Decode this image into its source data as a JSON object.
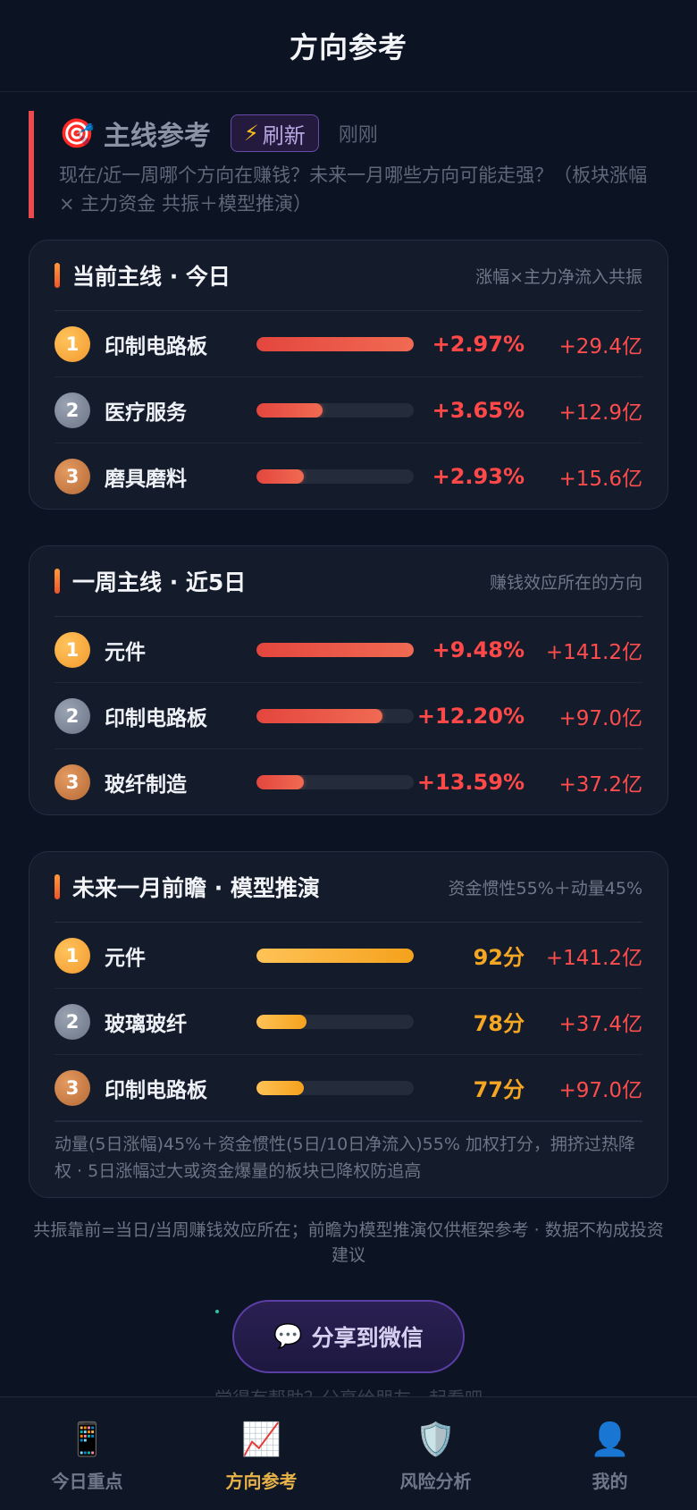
{
  "header": {
    "title": "方向参考"
  },
  "intro": {
    "icon": "🎯",
    "title": "主线参考",
    "refresh_icon": "⚡",
    "refresh_label": "刷新",
    "time": "刚刚",
    "description": "现在/近一周哪个方向在赚钱？未来一月哪些方向可能走强？（板块涨幅 × 主力资金 共振＋模型推演）"
  },
  "cards": [
    {
      "title": "当前主线 · 今日",
      "subtitle": "涨幅×主力净流入共振",
      "bar_style": "red",
      "rows": [
        {
          "rank": "1",
          "name": "印制电路板",
          "level": 1.0,
          "value": "+2.97%",
          "flow": "+29.4亿"
        },
        {
          "rank": "2",
          "name": "医疗服务",
          "level": 0.42,
          "value": "+3.65%",
          "flow": "+12.9亿"
        },
        {
          "rank": "3",
          "name": "磨具磨料",
          "level": 0.3,
          "value": "+2.93%",
          "flow": "+15.6亿"
        }
      ]
    },
    {
      "title": "一周主线 · 近5日",
      "subtitle": "赚钱效应所在的方向",
      "bar_style": "red",
      "rows": [
        {
          "rank": "1",
          "name": "元件",
          "level": 1.0,
          "value": "+9.48%",
          "flow": "+141.2亿"
        },
        {
          "rank": "2",
          "name": "印制电路板",
          "level": 0.8,
          "value": "+12.20%",
          "flow": "+97.0亿"
        },
        {
          "rank": "3",
          "name": "玻纤制造",
          "level": 0.3,
          "value": "+13.59%",
          "flow": "+37.2亿"
        }
      ]
    },
    {
      "title": "未来一月前瞻 · 模型推演",
      "subtitle": "资金惯性55%＋动量45%",
      "bar_style": "orange",
      "rows": [
        {
          "rank": "1",
          "name": "元件",
          "level": 1.0,
          "value": "92分",
          "flow": "+141.2亿"
        },
        {
          "rank": "2",
          "name": "玻璃玻纤",
          "level": 0.32,
          "value": "78分",
          "flow": "+37.4亿"
        },
        {
          "rank": "3",
          "name": "印制电路板",
          "level": 0.3,
          "value": "77分",
          "flow": "+97.0亿"
        }
      ],
      "note": "动量(5日涨幅)45%＋资金惯性(5日/10日净流入)55% 加权打分，拥挤过热降权 · 5日涨幅过大或资金爆量的板块已降权防追高"
    }
  ],
  "footer_note": "共振靠前=当日/当周赚钱效应所在；前瞻为模型推演仅供框架参考 · 数据不构成投资建议",
  "share": {
    "icon": "💬",
    "label": "分享到微信"
  },
  "peek_text": "觉得有帮助？分享给朋友一起看吧",
  "tabs": [
    {
      "icon": "📱",
      "label": "今日重点",
      "active": false
    },
    {
      "icon": "📈",
      "label": "方向参考",
      "active": true
    },
    {
      "icon": "🛡️",
      "label": "风险分析",
      "active": false
    },
    {
      "icon": "👤",
      "label": "我的",
      "active": false
    }
  ],
  "colors": {
    "accent_red": "#ff4848",
    "score_orange": "#f5a623",
    "active_tab": "#e8b348"
  }
}
